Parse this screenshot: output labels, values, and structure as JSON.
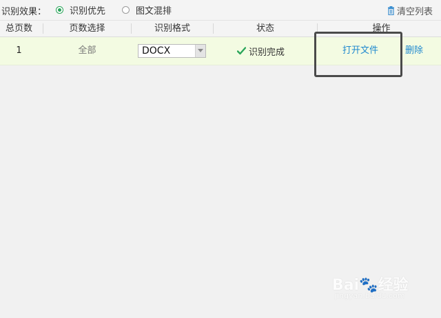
{
  "toolbar": {
    "effect_label": "识别效果：",
    "options": [
      {
        "label": "识别优先",
        "selected": true
      },
      {
        "label": "图文混排",
        "selected": false
      }
    ],
    "clear_label": "清空列表"
  },
  "table": {
    "headers": [
      "总页数",
      "页数选择",
      "识别格式",
      "状态",
      "操作"
    ],
    "rows": [
      {
        "total_pages": "1",
        "page_selection": "全部",
        "format": "DOCX",
        "status": "识别完成",
        "open_action": "打开文件",
        "delete_action": "删除"
      }
    ]
  },
  "watermark": {
    "logo": "Bai🐾经验",
    "url": "jingyan.baidu.com"
  },
  "colors": {
    "accent_green": "#2aa55a",
    "link_blue": "#1e88cf",
    "row_highlight": "#f3fbe2"
  },
  "icons": {
    "clear": "trash-icon",
    "status": "check-icon"
  }
}
